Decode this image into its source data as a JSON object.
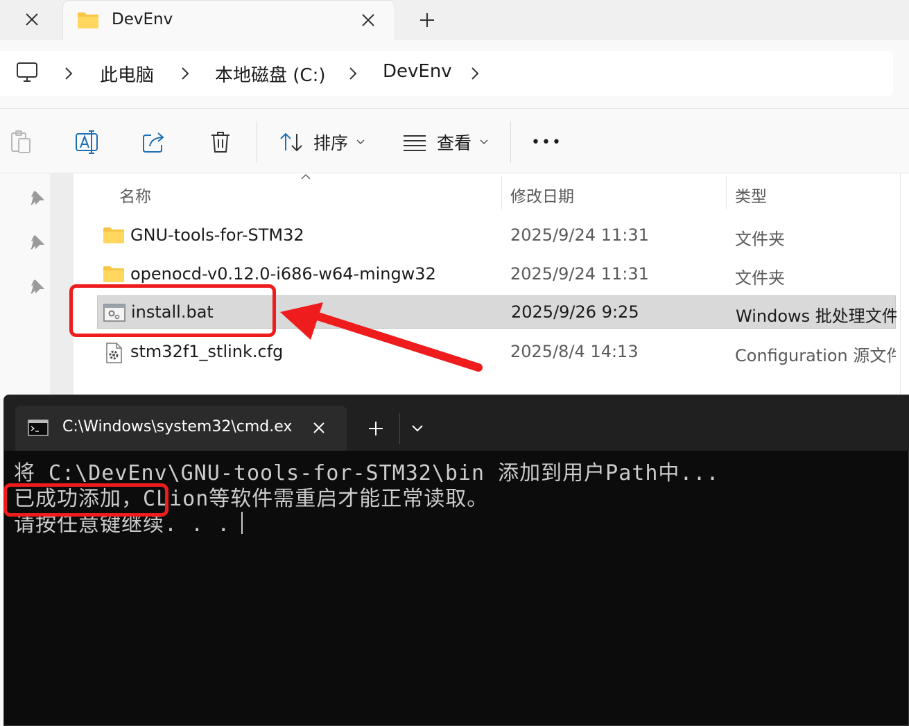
{
  "explorer": {
    "tab_title": "DevEnv",
    "breadcrumb": [
      "此电脑",
      "本地磁盘 (C:)",
      "DevEnv"
    ],
    "toolbar": {
      "sort_label": "排序",
      "view_label": "查看",
      "more_label": "•••"
    },
    "columns": {
      "name": "名称",
      "modified": "修改日期",
      "type": "类型"
    },
    "files": [
      {
        "name": "GNU-tools-for-STM32",
        "modified": "2025/9/24 11:31",
        "type": "文件夹",
        "icon": "folder-icon"
      },
      {
        "name": "openocd-v0.12.0-i686-w64-mingw32",
        "modified": "2025/9/24 11:31",
        "type": "文件夹",
        "icon": "folder-icon"
      },
      {
        "name": "install.bat",
        "modified": "2025/9/26 9:25",
        "type": "Windows 批处理文件",
        "icon": "batch-file-icon",
        "selected": true
      },
      {
        "name": "stm32f1_stlink.cfg",
        "modified": "2025/8/4 14:13",
        "type": "Configuration 源文件",
        "icon": "config-file-icon"
      }
    ]
  },
  "terminal": {
    "tab_title": "C:\\Windows\\system32\\cmd.ex",
    "lines": [
      "将 C:\\DevEnv\\GNU-tools-for-STM32\\bin 添加到用户Path中...",
      "已成功添加，CLion等软件需重启才能正常读取。",
      "请按任意键继续. . ."
    ]
  },
  "colors": {
    "annotation_red": "#ee1c1c",
    "selected_row": "#d9d9d9",
    "terminal_bg": "#0c0c0c",
    "folder_yellow": "#f6c644"
  }
}
